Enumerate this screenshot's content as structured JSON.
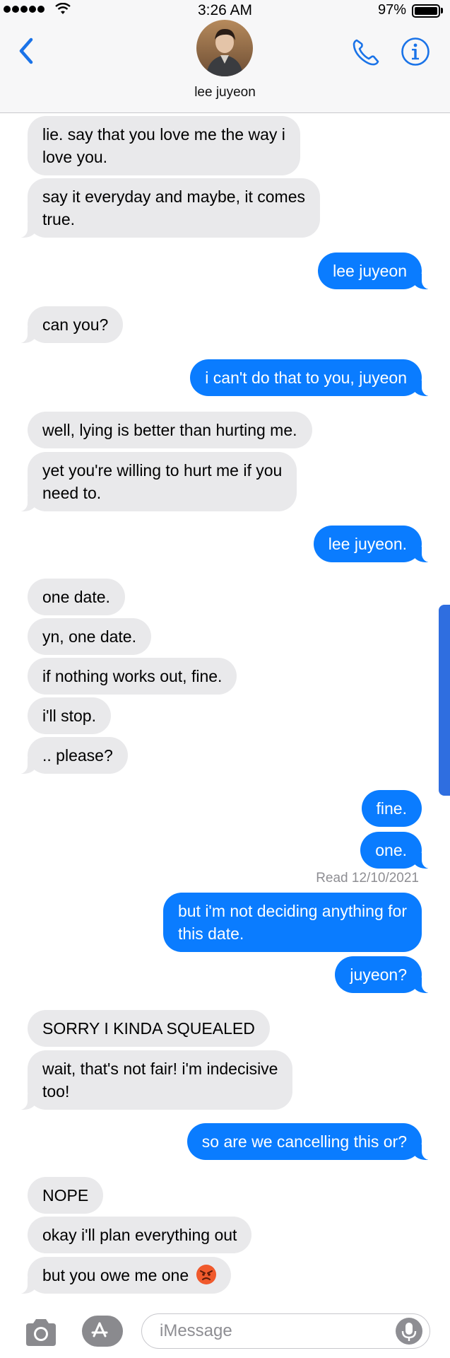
{
  "status_bar": {
    "time": "3:26 AM",
    "battery": "97%"
  },
  "header": {
    "contact_name": "lee juyeon"
  },
  "messages": [
    {
      "side": "received",
      "text": "lie. say that you love me the way i\nlove you."
    },
    {
      "side": "received",
      "text": "say it everyday and maybe, it comes\ntrue."
    },
    {
      "side": "sent",
      "text": "lee juyeon"
    },
    {
      "side": "received",
      "text": "can you?"
    },
    {
      "side": "sent",
      "text": "i can't do that to you, juyeon"
    },
    {
      "side": "received",
      "text": "well, lying is better than hurting me."
    },
    {
      "side": "received",
      "text": "yet you're willing to hurt me if you\nneed to."
    },
    {
      "side": "sent",
      "text": "lee juyeon."
    },
    {
      "side": "received",
      "text": "one date."
    },
    {
      "side": "received",
      "text": "yn, one date."
    },
    {
      "side": "received",
      "text": "if nothing works out, fine."
    },
    {
      "side": "received",
      "text": "i'll stop."
    },
    {
      "side": "received",
      "text": ".. please?"
    },
    {
      "side": "sent",
      "text": "fine."
    },
    {
      "side": "sent",
      "text": "one."
    },
    {
      "side": "sent",
      "text": "but i'm not deciding anything for\nthis date."
    },
    {
      "side": "sent",
      "text": "juyeon?"
    },
    {
      "side": "received",
      "text": "SORRY I KINDA SQUEALED"
    },
    {
      "side": "received",
      "text": "wait, that's not fair! i'm indecisive\ntoo!"
    },
    {
      "side": "sent",
      "text": "so are we cancelling this or?"
    },
    {
      "side": "received",
      "text": "NOPE"
    },
    {
      "side": "received",
      "text": "okay i'll plan everything out"
    },
    {
      "side": "received",
      "text": "but you owe me one",
      "emoji": "angry-face-emoji"
    }
  ],
  "read_receipt": "Read 12/10/2021",
  "input": {
    "placeholder": "iMessage"
  },
  "icons": {
    "back": "chevron-left-icon",
    "call": "phone-icon",
    "info": "info-icon",
    "camera": "camera-icon",
    "apps": "app-store-icon",
    "mic": "microphone-icon"
  },
  "colors": {
    "accent": "#0a7cff",
    "received_bubble": "#e9e9eb",
    "sent_bubble": "#0a7cff"
  }
}
